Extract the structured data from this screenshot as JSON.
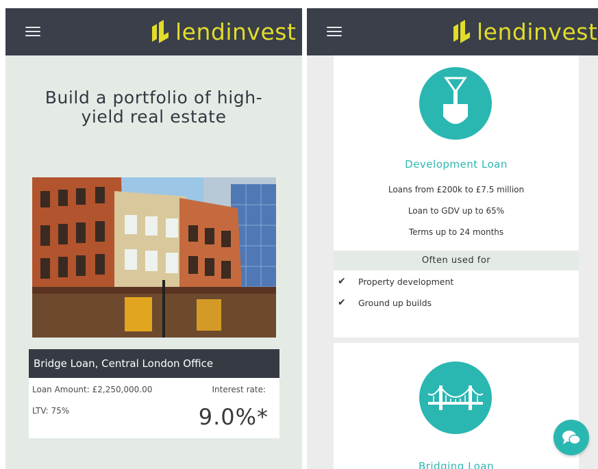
{
  "brand": {
    "name": "lendinvest",
    "logo_color": "#e2dc2a",
    "header_color": "#3a3f4a",
    "accent": "#2bb7b1"
  },
  "left_screen": {
    "menu_icon": "hamburger-icon",
    "headline": "Build a portfolio of high-yield real estate",
    "photo_alt_icon": "building-photo",
    "loan_card": {
      "title": "Bridge Loan, Central London Office",
      "loan_amount": "Loan Amount: £2,250,000.00",
      "ltv": "LTV: 75%",
      "interest_label": "Interest rate:",
      "interest_rate": "9.0%*"
    }
  },
  "right_screen": {
    "menu_icon": "hamburger-icon",
    "products": [
      {
        "icon": "shovel-icon",
        "title": "Development Loan",
        "lines": [
          "Loans from £200k to £7.5 million",
          "Loan to GDV up to 65%",
          "Terms up to 24 months"
        ],
        "often_used_label": "Often used for",
        "uses": [
          "Property development",
          "Ground up builds"
        ]
      },
      {
        "icon": "bridge-icon",
        "title": "Bridging Loan"
      }
    ],
    "chat_icon": "chat-bubbles-icon"
  }
}
